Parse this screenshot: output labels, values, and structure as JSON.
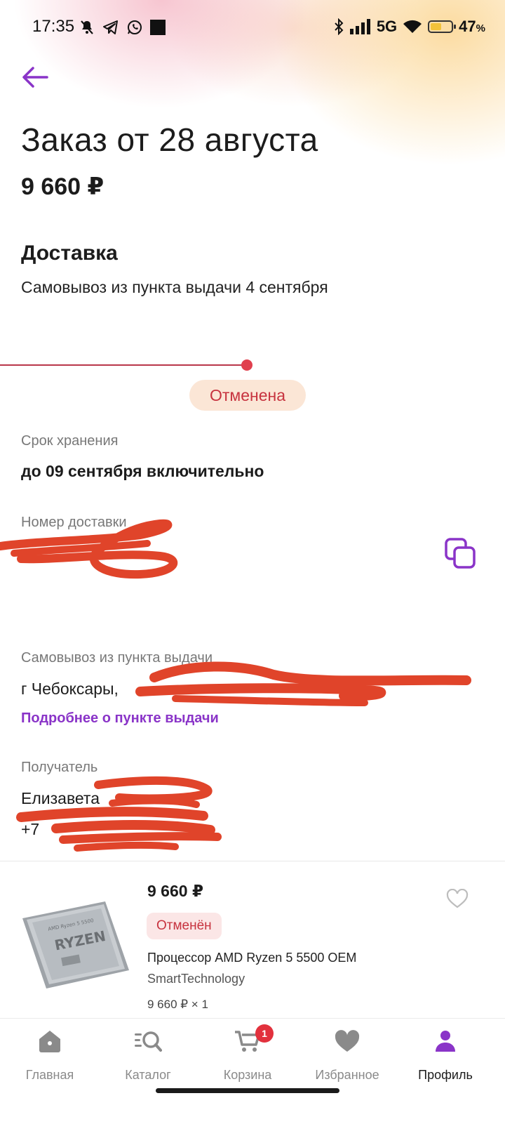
{
  "status_bar": {
    "time": "17:35",
    "network": "5G",
    "battery": "47",
    "battery_unit": "%",
    "battery_level": 0.47,
    "icons_left": [
      "mute-icon",
      "telegram-icon",
      "whatsapp-icon",
      "square-icon"
    ],
    "icons_right": [
      "bluetooth-icon",
      "signal-icon",
      "wifi-icon",
      "battery-icon"
    ]
  },
  "header": {
    "back_icon": "arrow-left-icon",
    "title": "Заказ от 28 августа",
    "total": "9 660 ₽"
  },
  "delivery": {
    "heading": "Доставка",
    "description": "Самовывоз из пункта выдачи 4 сентября",
    "status": "Отменена"
  },
  "storage": {
    "label": "Срок хранения",
    "value": "до 09 сентября включительно"
  },
  "delivery_number": {
    "label": "Номер доставки",
    "copy_icon": "copy-icon"
  },
  "pickup": {
    "label": "Самовывоз из пункта выдачи",
    "address_visible": "г Чебоксары,",
    "details_link": "Подробнее о пункте выдачи"
  },
  "recipient": {
    "label": "Получатель",
    "name_visible": "Елизавета",
    "phone_visible": "+7"
  },
  "item": {
    "price": "9 660 ₽",
    "status": "Отменён",
    "name": "Процессор AMD Ryzen 5 5500 OEM",
    "seller": "SmartTechnology",
    "qty_line": "9 660 ₽ × 1",
    "image_text": "RYZEN",
    "image_subtext": "AMD Ryzen 5 5500"
  },
  "nav": {
    "items": [
      {
        "label": "Главная",
        "icon": "home-icon"
      },
      {
        "label": "Каталог",
        "icon": "catalog-search-icon"
      },
      {
        "label": "Корзина",
        "icon": "cart-icon",
        "badge": "1"
      },
      {
        "label": "Избранное",
        "icon": "heart-icon"
      },
      {
        "label": "Профиль",
        "icon": "profile-icon",
        "active": true
      }
    ]
  },
  "colors": {
    "accent": "#8a34c8",
    "danger": "#c7333f",
    "badge_bg": "#fbe6d6",
    "redaction": "#e0442a"
  }
}
